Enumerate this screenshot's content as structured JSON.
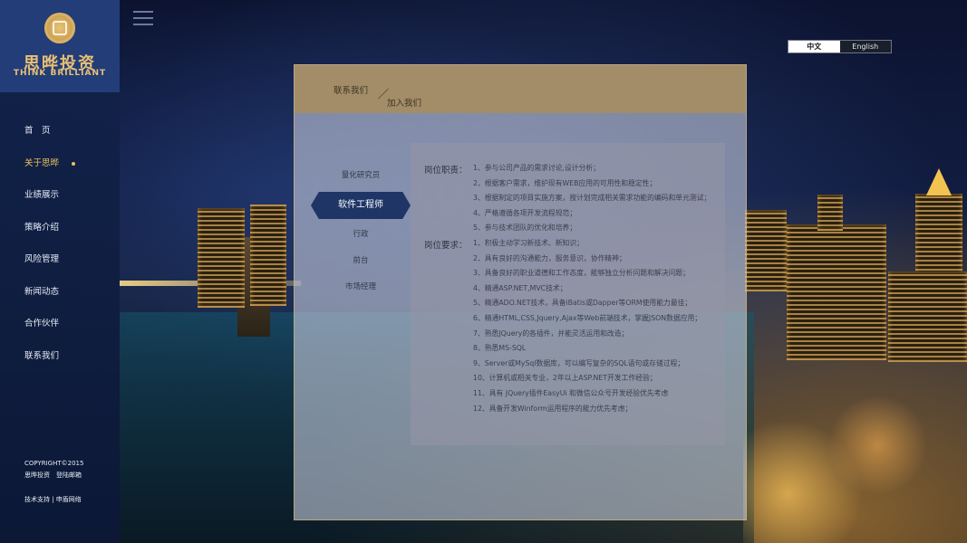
{
  "brand": {
    "name_cn": "思晔投资",
    "name_en": "THINK BRILLIANT"
  },
  "nav": {
    "items": [
      {
        "label": "首　页"
      },
      {
        "label": "关于思晔"
      },
      {
        "label": "业绩展示"
      },
      {
        "label": "策略介绍"
      },
      {
        "label": "风险管理"
      },
      {
        "label": "新闻动态"
      },
      {
        "label": "合作伙伴"
      },
      {
        "label": "联系我们"
      }
    ],
    "active_index": 1
  },
  "footer": {
    "copyright": "COPYRIGHT©2015",
    "company_links": "思晔投资　登陆邮箱",
    "tech_support": "技术支持 | 申盾网络"
  },
  "language": {
    "zh": "中文",
    "en": "English",
    "selected": "中文"
  },
  "breadcrumb": {
    "parent": "联系我们",
    "current": "加入我们"
  },
  "jobs": {
    "items": [
      {
        "label": "量化研究员"
      },
      {
        "label": "软件工程师"
      },
      {
        "label": "行政"
      },
      {
        "label": "前台"
      },
      {
        "label": "市场经理"
      }
    ],
    "active_index": 1
  },
  "detail": {
    "duties_label": "岗位职责：",
    "duties": [
      "1、参与公司产品的需求讨论,设计分析；",
      "2、根据客户需求，维护现有WEB应用的可用性和稳定性；",
      "3、根据制定的项目实施方案，按计划完成相关需求功能的编码和单元测试；",
      "4、严格遵循各项开发流程规范；",
      "5、参与技术团队的优化和培养；"
    ],
    "requirements_label": "岗位要求：",
    "requirements": [
      "1、积极主动学习新技术、新知识；",
      "2、具有良好的沟通能力，服务意识，协作精神；",
      "3、具备良好的职业道德和工作态度，能够独立分析问题和解决问题；",
      "4、精通ASP.NET,MVC技术；",
      "5、精通ADO.NET技术，具备iBatis或Dapper等ORM使用能力最佳；",
      "6、精通HTML,CSS,Jquery,Ajax等Web前端技术，掌握JSON数据应用；",
      "7、熟悉JQuery的各插件，并能灵活运用和改造；",
      "8、熟悉MS-SQL",
      "9、Server或MySql数据库，可以编写复杂的SQL语句或存储过程；",
      "10、计算机或相关专业，2年以上ASP.NET开发工作经验；",
      "11、具有 JQuery插件EasyUi 和微信公众号开发经验优先考虑",
      "12、具备开发Winform运用程序的能力优先考虑；"
    ]
  },
  "colors": {
    "sidebar": "#12234b",
    "logo_bg": "#233d78",
    "gold": "#e9c25b",
    "panel_head": "#a38d68",
    "active_job": "#1f3566"
  },
  "icons": {
    "menu": "hamburger-menu-icon",
    "logo": "logo-emblem-icon"
  }
}
